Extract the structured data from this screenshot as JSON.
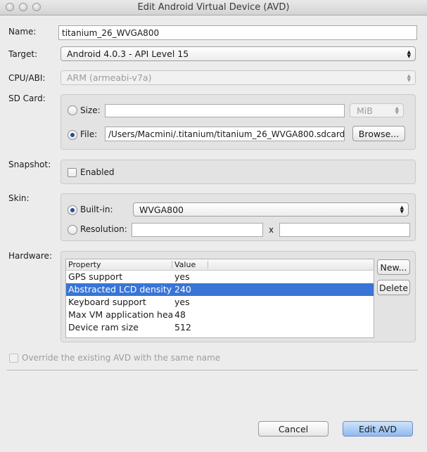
{
  "window": {
    "title": "Edit Android Virtual Device (AVD)"
  },
  "name": {
    "label": "Name:",
    "value": "titanium_26_WVGA800"
  },
  "target": {
    "label": "Target:",
    "value": "Android 4.0.3 - API Level 15"
  },
  "cpu": {
    "label": "CPU/ABI:",
    "value": "ARM (armeabi-v7a)"
  },
  "sdcard": {
    "label": "SD Card:",
    "size_label": "Size:",
    "size_value": "",
    "unit": "MiB",
    "file_label": "File:",
    "file_value": "/Users/Macmini/.titanium/titanium_26_WVGA800.sdcard",
    "browse_label": "Browse...",
    "selected": "file"
  },
  "snapshot": {
    "label": "Snapshot:",
    "enabled_label": "Enabled",
    "enabled": false
  },
  "skin": {
    "label": "Skin:",
    "builtin_label": "Built-in:",
    "builtin_value": "WVGA800",
    "resolution_label": "Resolution:",
    "res_x": "",
    "res_sep": "x",
    "res_y": "",
    "selected": "builtin"
  },
  "hardware": {
    "label": "Hardware:",
    "columns": [
      "Property",
      "Value"
    ],
    "rows": [
      {
        "property": "GPS support",
        "value": "yes"
      },
      {
        "property": "Abstracted LCD density",
        "value": "240"
      },
      {
        "property": "Keyboard support",
        "value": "yes"
      },
      {
        "property": "Max VM application heap size",
        "value": "48"
      },
      {
        "property": "Device ram size",
        "value": "512"
      }
    ],
    "selected_row": 1,
    "new_label": "New...",
    "delete_label": "Delete"
  },
  "override": {
    "label": "Override the existing AVD with the same name",
    "checked": false
  },
  "footer": {
    "cancel_label": "Cancel",
    "submit_label": "Edit AVD"
  }
}
